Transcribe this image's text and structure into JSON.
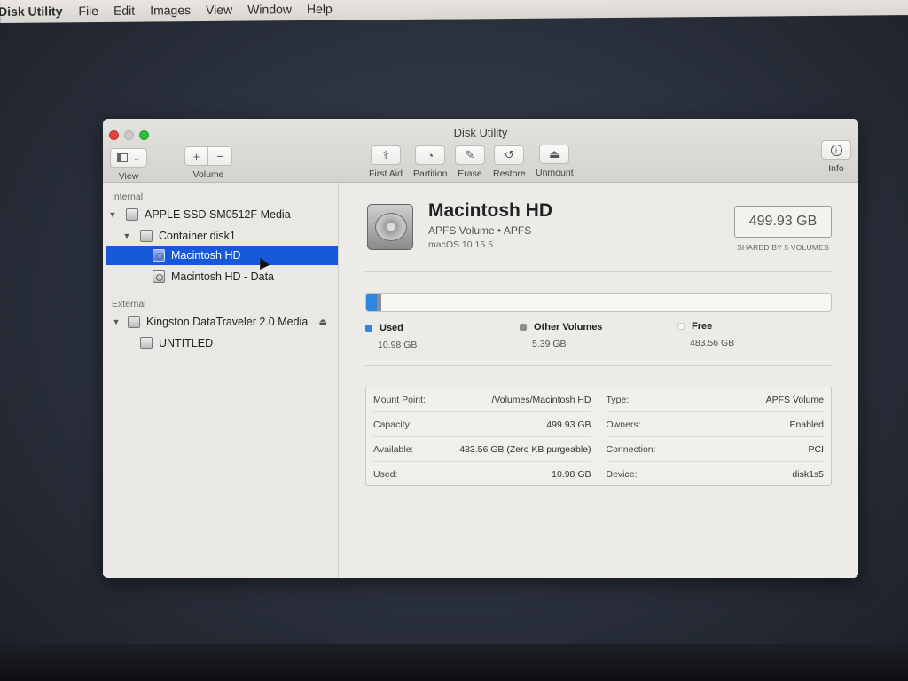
{
  "menubar": {
    "app_name": "Disk Utility",
    "items": [
      "File",
      "Edit",
      "Images",
      "View",
      "Window",
      "Help"
    ]
  },
  "window": {
    "title": "Disk Utility"
  },
  "toolbar": {
    "view_label": "View",
    "volume_label": "Volume",
    "add_symbol": "+",
    "remove_symbol": "−",
    "first_aid": "First Aid",
    "partition": "Partition",
    "erase": "Erase",
    "restore": "Restore",
    "unmount": "Unmount",
    "info": "Info"
  },
  "sidebar": {
    "internal_label": "Internal",
    "external_label": "External",
    "items": [
      {
        "label": "APPLE SSD SM0512F Media"
      },
      {
        "label": "Container disk1"
      },
      {
        "label": "Macintosh HD"
      },
      {
        "label": "Macintosh HD - Data"
      },
      {
        "label": "Kingston DataTraveler 2.0 Media"
      },
      {
        "label": "UNTITLED"
      }
    ]
  },
  "volume": {
    "name": "Macintosh HD",
    "type_line": "APFS Volume • APFS",
    "os_line": "macOS 10.15.5",
    "capacity": "499.93 GB",
    "shared_note": "SHARED BY 5 VOLUMES"
  },
  "usage": {
    "used_label": "Used",
    "used_value": "10.98 GB",
    "other_label": "Other Volumes",
    "other_value": "5.39 GB",
    "free_label": "Free",
    "free_value": "483.56 GB",
    "used_fraction": 0.022,
    "other_fraction": 0.011,
    "colors": {
      "used": "#2b87e0",
      "other": "#8d8d8d",
      "free": "#f8f7f3"
    }
  },
  "info": {
    "left": [
      {
        "key": "Mount Point:",
        "value": "/Volumes/Macintosh HD"
      },
      {
        "key": "Capacity:",
        "value": "499.93 GB"
      },
      {
        "key": "Available:",
        "value": "483.56 GB (Zero KB purgeable)"
      },
      {
        "key": "Used:",
        "value": "10.98 GB"
      }
    ],
    "right": [
      {
        "key": "Type:",
        "value": "APFS Volume"
      },
      {
        "key": "Owners:",
        "value": "Enabled"
      },
      {
        "key": "Connection:",
        "value": "PCI"
      },
      {
        "key": "Device:",
        "value": "disk1s5"
      }
    ]
  }
}
